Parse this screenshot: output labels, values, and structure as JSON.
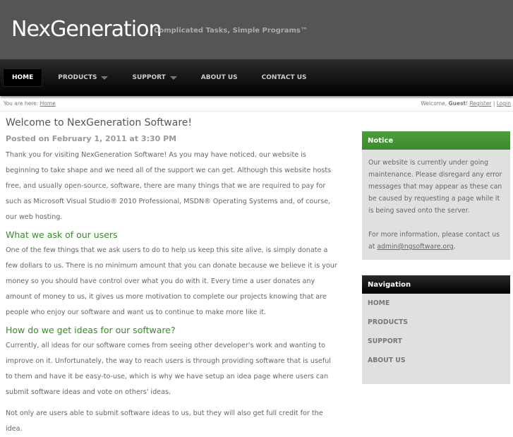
{
  "header": {
    "logo": "NexGeneration",
    "tagline": "Complicated Tasks, Simple Programs™"
  },
  "nav": [
    {
      "label": "HOME"
    },
    {
      "label": "PRODUCTS"
    },
    {
      "label": "SUPPORT"
    },
    {
      "label": "ABOUT US"
    },
    {
      "label": "CONTACT US"
    }
  ],
  "breadcrumb": {
    "prefix": "You are here:",
    "home": "Home"
  },
  "user": {
    "welcome": "Welcome,",
    "name": "Guest",
    "excl": "!",
    "register": "Register",
    "sep": "|",
    "login": "Login"
  },
  "post": {
    "title": "Welcome to NexGeneration Software!",
    "posted": "Posted on February 1, 2011 at 3:30 PM",
    "p1": "Thank you for visiting NexGeneration Software! As you may have noticed, our website is beginning to take shape and we need all of the support we can get. Although this website hosts free, and usually open-source, software, there are many things that we are required to pay for such as Microsoft Visual Studio® 2010 Professional, MSDN® Operating Systems and, of course, our web hosting.",
    "h2a": "What we ask of our users",
    "p2": "One of the few things that we ask users to do to help us keep this site alive, is simply donate a few dollars to us. There is no minimum amount that you can donate because we believe it is your money so you should have control over what you do with it. Every time a user donates any amount of money to us, it gives us more motivation to complete our projects knowing that are people who enjoy our software and want us to continue to make more like it.",
    "h2b": "How do we get ideas for our software?",
    "p3": "Currently, all ideas for our software comes from seeing other developer's work and wanting to improve on it. Unfortunately, the way to reach users is through providing software that is useful to them and have it be easy-to-use, which is why we have setup an idea page where users can submit software ideas and vote on others' ideas.",
    "p4": "Not only are users able to submit software ideas to us, but they will also get full credit for the idea."
  },
  "notice": {
    "title": "Notice",
    "text": "Our website is currently under going maintenance. Please disregard any error messages that may appear as these can be caused by requesting a page while it is being saved onto the server.",
    "more": "For more information, please contact us at",
    "email": "admin@ngsoftware.org",
    "end": "."
  },
  "sidenav": {
    "title": "Navigation",
    "items": [
      "HOME",
      "PRODUCTS",
      "SUPPORT",
      "ABOUT US"
    ]
  }
}
